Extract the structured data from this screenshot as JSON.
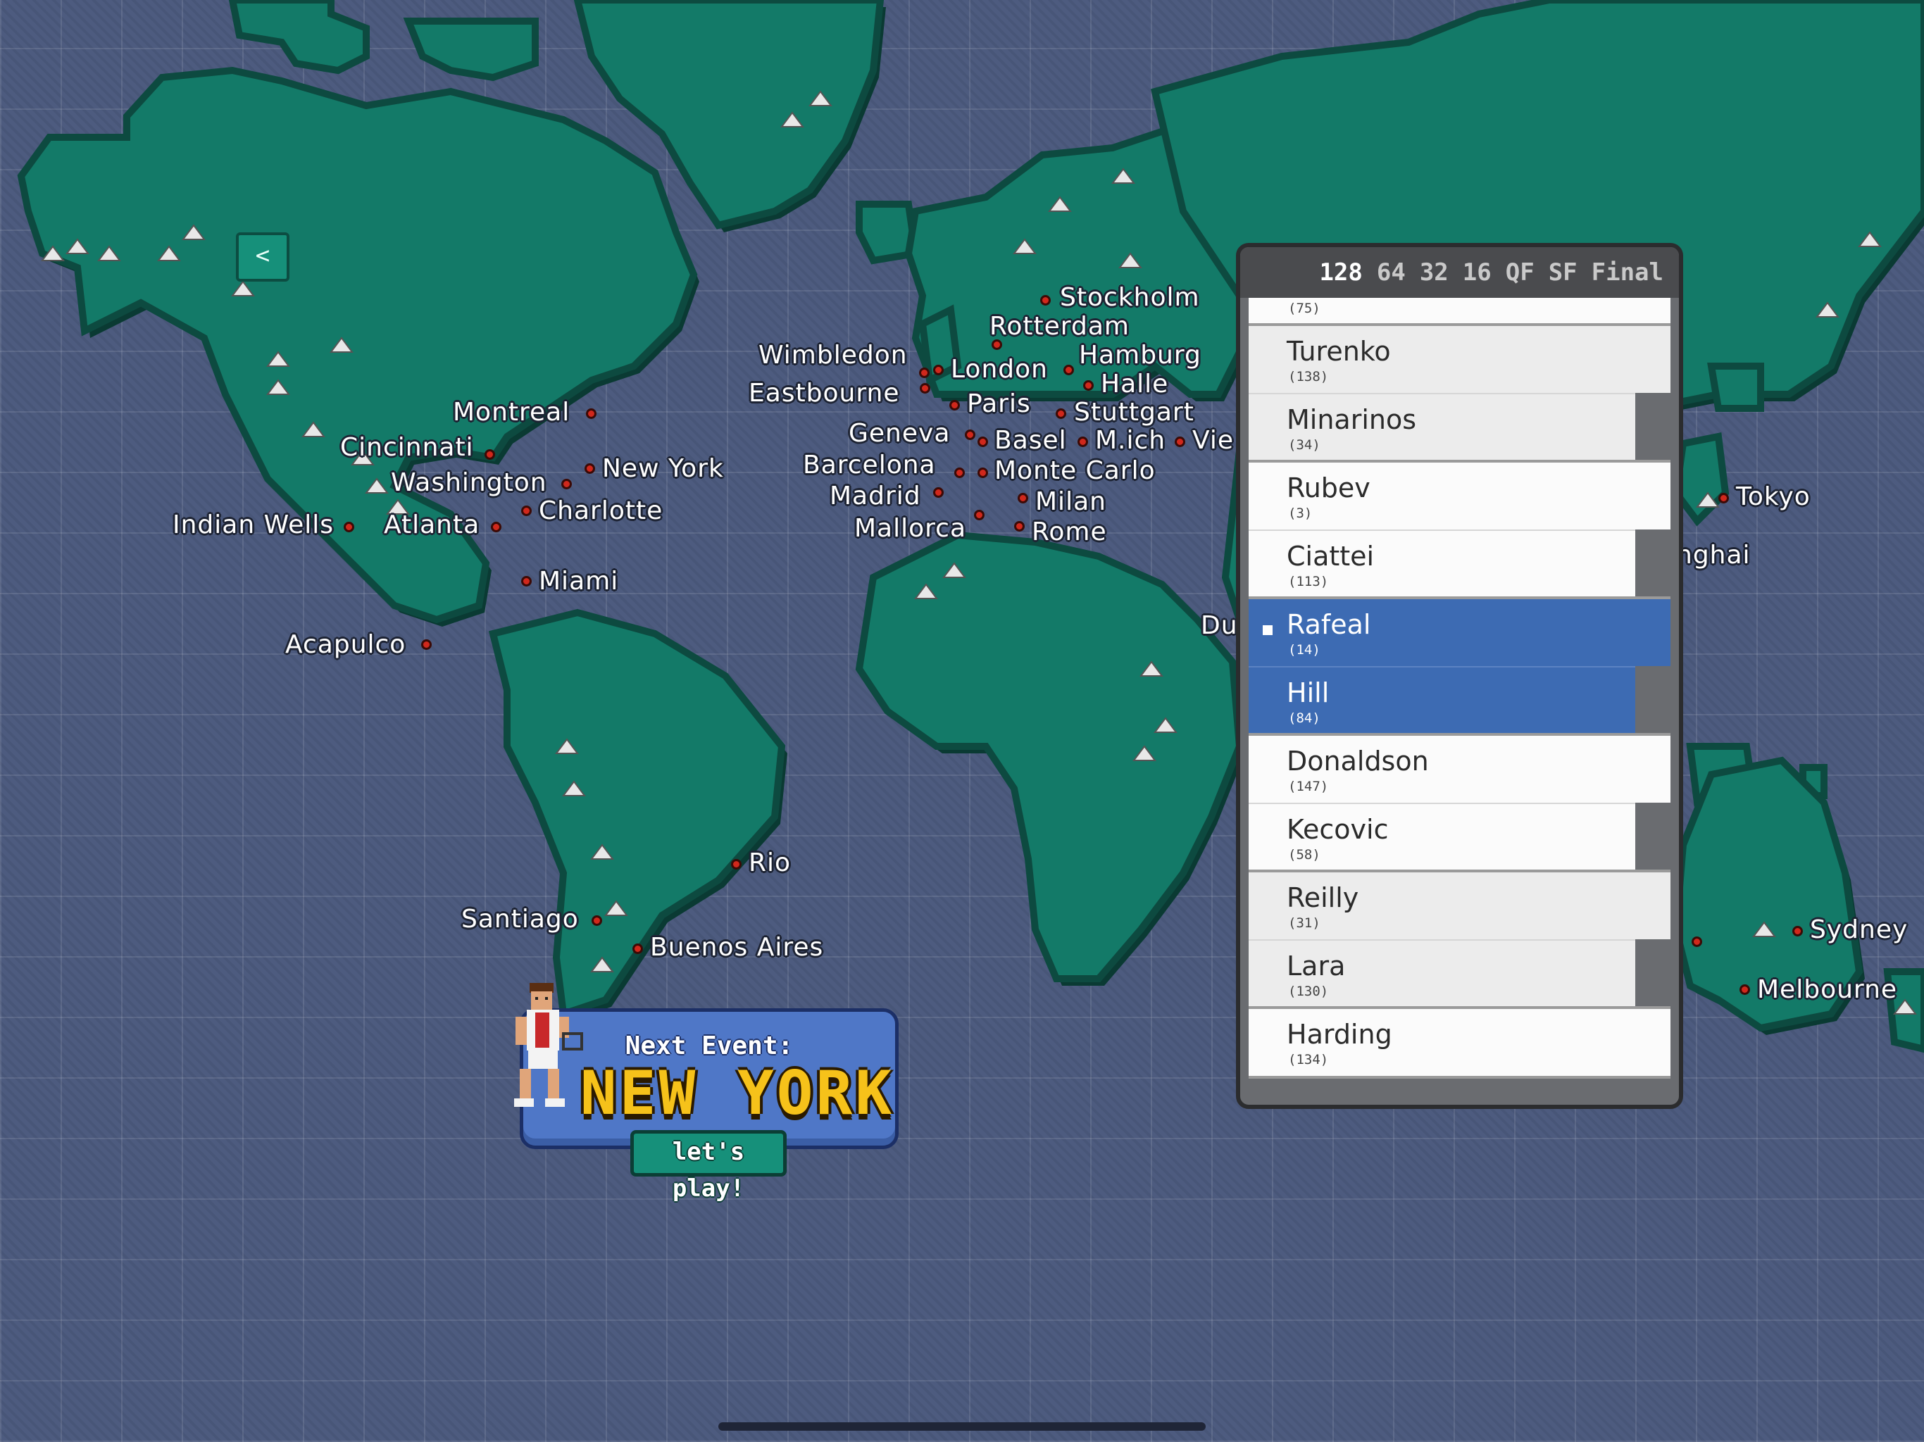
{
  "cities": [
    {
      "name": "Stockholm"
    },
    {
      "name": "Rotterdam"
    },
    {
      "name": "Wimbledon"
    },
    {
      "name": "London"
    },
    {
      "name": "Hamburg"
    },
    {
      "name": "Eastbourne"
    },
    {
      "name": "Halle"
    },
    {
      "name": "Paris"
    },
    {
      "name": "Stuttgart"
    },
    {
      "name": "Geneva"
    },
    {
      "name": "Basel"
    },
    {
      "name": "M.ich"
    },
    {
      "name": "Vie"
    },
    {
      "name": "Barcelona"
    },
    {
      "name": "Monte Carlo"
    },
    {
      "name": "Madrid"
    },
    {
      "name": "Milan"
    },
    {
      "name": "Mallorca"
    },
    {
      "name": "Rome"
    },
    {
      "name": "Montreal"
    },
    {
      "name": "Cincinnati"
    },
    {
      "name": "New York"
    },
    {
      "name": "Washington"
    },
    {
      "name": "Charlotte"
    },
    {
      "name": "Indian Wells"
    },
    {
      "name": "Atlanta"
    },
    {
      "name": "Miami"
    },
    {
      "name": "Acapulco"
    },
    {
      "name": "Rio"
    },
    {
      "name": "Santiago"
    },
    {
      "name": "Buenos Aires"
    },
    {
      "name": "Tokyo"
    },
    {
      "name": "nghai"
    },
    {
      "name": "Du"
    },
    {
      "name": "Sydney"
    },
    {
      "name": "Melbourne"
    }
  ],
  "back_button": {
    "icon": "chevron-left-icon",
    "label": "<"
  },
  "draw": {
    "rounds": [
      "128",
      "64",
      "32",
      "16",
      "QF",
      "SF",
      "Final"
    ],
    "active_round": "128",
    "partial_rank": "(75)",
    "matches": [
      {
        "style": "grey",
        "players": [
          {
            "name": "Turenko",
            "rank": "(138)"
          },
          {
            "name": "Minarinos",
            "rank": "(34)"
          }
        ]
      },
      {
        "style": "white",
        "players": [
          {
            "name": "Rubev",
            "rank": "(3)"
          },
          {
            "name": "Ciattei",
            "rank": "(113)"
          }
        ]
      },
      {
        "style": "sel",
        "players": [
          {
            "name": "Rafeal",
            "rank": "(14)"
          },
          {
            "name": "Hill",
            "rank": "(84)"
          }
        ]
      },
      {
        "style": "white",
        "players": [
          {
            "name": "Donaldson",
            "rank": "(147)"
          },
          {
            "name": "Kecovic",
            "rank": "(58)"
          }
        ]
      },
      {
        "style": "grey",
        "players": [
          {
            "name": "Reilly",
            "rank": "(31)"
          },
          {
            "name": "Lara",
            "rank": "(130)"
          }
        ]
      },
      {
        "style": "white",
        "players": [
          {
            "name": "Harding",
            "rank": "(134)"
          }
        ]
      }
    ]
  },
  "next_event": {
    "label": "Next Event:",
    "city": "NEW YORK",
    "button": "let's play!"
  },
  "colors": {
    "land": "#137a68",
    "ocean": "#4d5b7f",
    "selected": "#3d6bb3",
    "accent": "#f6c21a"
  }
}
